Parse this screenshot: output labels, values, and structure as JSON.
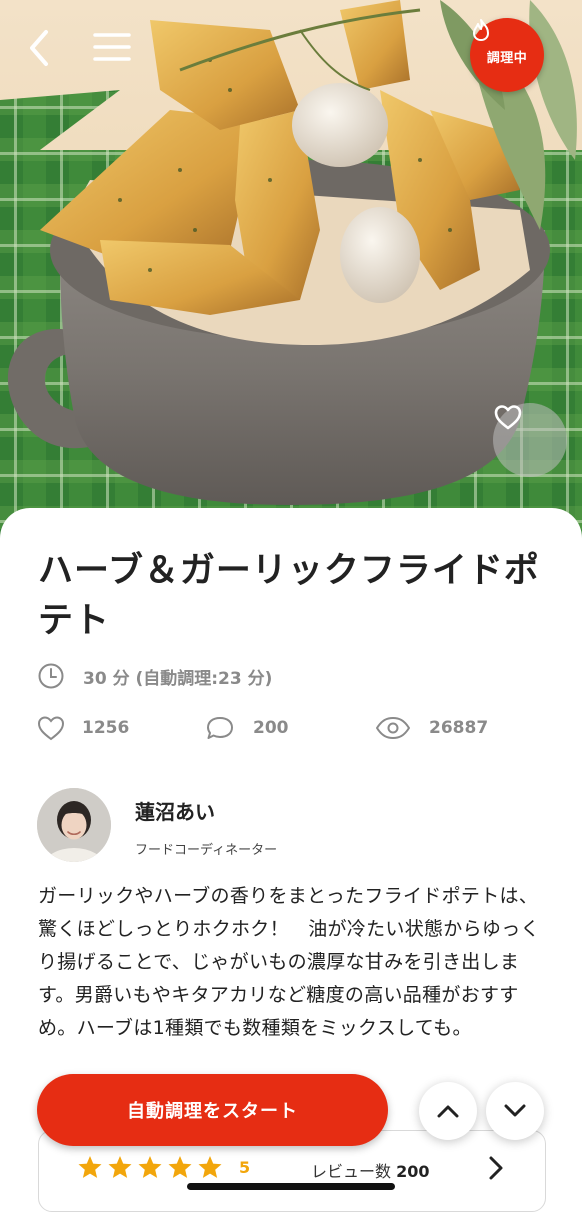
{
  "header": {
    "cooking_badge_label": "調理中"
  },
  "recipe": {
    "title": "ハーブ＆ガーリックフライドポテト",
    "time_text": "30 分 (自動調理:23 分)",
    "likes": "1256",
    "comments": "200",
    "views": "26887",
    "description": "ガーリックやハーブの香りをまとったフライドポテトは、驚くほどしっとりホクホク！　油が冷たい状態からゆっくり揚げることで、じゃがいもの濃厚な甘みを引き出します。男爵いもやキタアカリなど糖度の高い品種がおすすめ。ハーブは1種類でも数種類をミックスしても。"
  },
  "author": {
    "name": "蓮沼あい",
    "role": "フードコーディネーター"
  },
  "actions": {
    "start_label": "自動調理をスタート"
  },
  "reviews": {
    "rating": "5",
    "rating_value": 5,
    "count_label": "レビュー数",
    "count": "200"
  },
  "colors": {
    "accent": "#e62d13",
    "star": "#f2a60c",
    "meta_gray": "#8a8a8a"
  },
  "icons": [
    "back-arrow-icon",
    "hamburger-menu-icon",
    "flame-icon",
    "heart-icon",
    "clock-icon",
    "speech-bubble-icon",
    "eye-icon",
    "chevron-up-icon",
    "chevron-down-icon",
    "chevron-right-icon",
    "star-icon"
  ]
}
